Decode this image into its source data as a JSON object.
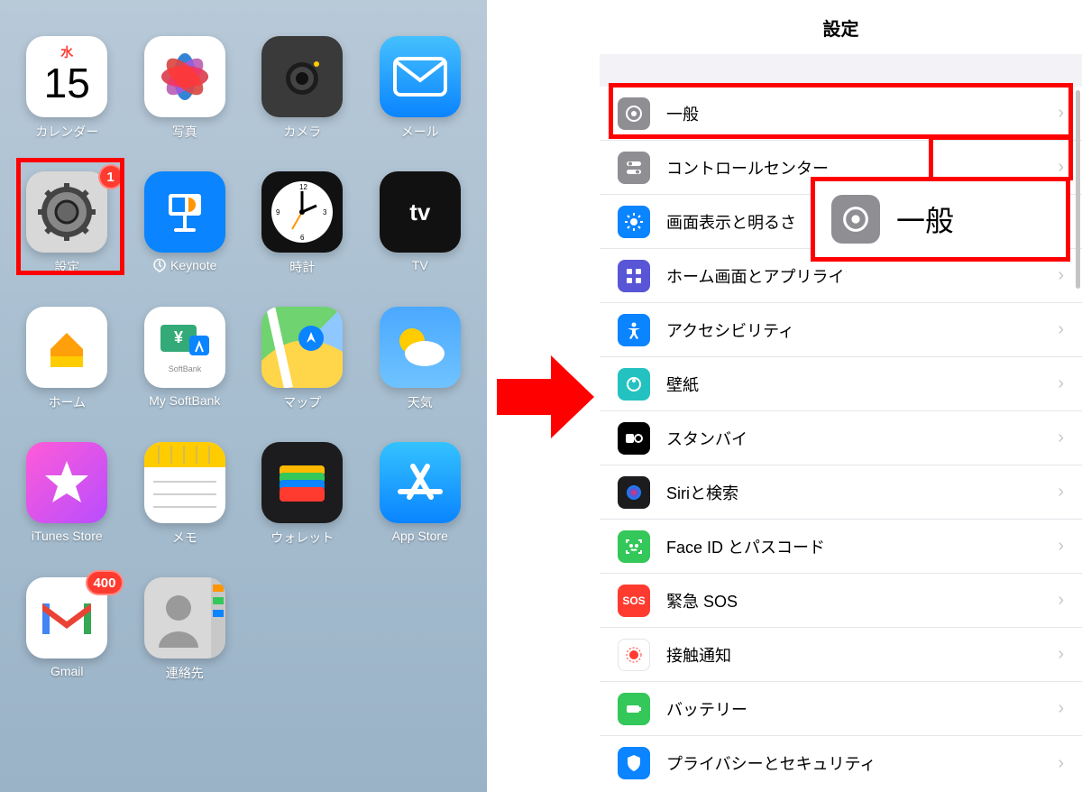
{
  "home": {
    "apps": [
      {
        "id": "calendar",
        "label": "カレンダー",
        "dow": "水",
        "day": "15"
      },
      {
        "id": "photos",
        "label": "写真"
      },
      {
        "id": "camera",
        "label": "カメラ"
      },
      {
        "id": "mail",
        "label": "メール"
      },
      {
        "id": "settings",
        "label": "設定",
        "badge": "1"
      },
      {
        "id": "keynote",
        "label": "Keynote"
      },
      {
        "id": "clock",
        "label": "時計"
      },
      {
        "id": "tv",
        "label": "TV",
        "text": "tv"
      },
      {
        "id": "home",
        "label": "ホーム"
      },
      {
        "id": "mysoftbank",
        "label": "My SoftBank"
      },
      {
        "id": "maps",
        "label": "マップ"
      },
      {
        "id": "weather",
        "label": "天気"
      },
      {
        "id": "itunes",
        "label": "iTunes Store"
      },
      {
        "id": "notes",
        "label": "メモ"
      },
      {
        "id": "wallet",
        "label": "ウォレット"
      },
      {
        "id": "appstore",
        "label": "App Store"
      },
      {
        "id": "gmail",
        "label": "Gmail",
        "badge": "400"
      },
      {
        "id": "contacts",
        "label": "連絡先"
      }
    ],
    "highlight_app_index": 4
  },
  "settings": {
    "title": "設定",
    "rows": [
      {
        "id": "general",
        "label": "一般"
      },
      {
        "id": "control-center",
        "label": "コントロールセンター"
      },
      {
        "id": "display",
        "label": "画面表示と明るさ"
      },
      {
        "id": "home-screen",
        "label": "ホーム画面とアプリライブラリ"
      },
      {
        "id": "accessibility",
        "label": "アクセシビリティ"
      },
      {
        "id": "wallpaper",
        "label": "壁紙"
      },
      {
        "id": "standby",
        "label": "スタンバイ"
      },
      {
        "id": "siri",
        "label": "Siriと検索"
      },
      {
        "id": "faceid",
        "label": "Face ID とパスコード"
      },
      {
        "id": "sos",
        "label": "緊急 SOS",
        "icon_text": "SOS"
      },
      {
        "id": "exposure",
        "label": "接触通知"
      },
      {
        "id": "battery",
        "label": "バッテリー"
      },
      {
        "id": "privacy",
        "label": "プライバシーとセキュリティ"
      }
    ],
    "highlight_row_index": 0,
    "callout_label": "一般"
  }
}
